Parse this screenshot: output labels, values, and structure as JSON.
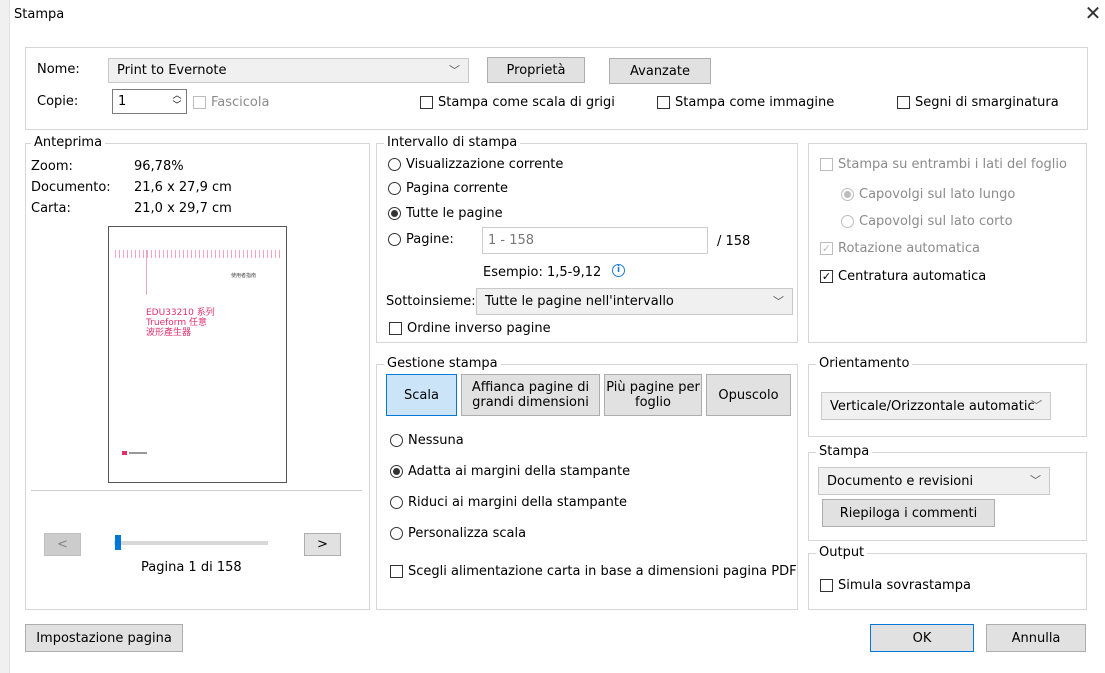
{
  "window": {
    "title": "Stampa",
    "close_icon": "close-icon"
  },
  "printer": {
    "name_label": "Nome:",
    "name_value": "Print to Evernote",
    "properties_label": "Proprietà",
    "advanced_label": "Avanzate",
    "copies_label": "Copie:",
    "copies_value": "1",
    "collate_label": "Fascicola",
    "grayscale_label": "Stampa come scala di grigi",
    "as_image_label": "Stampa come immagine",
    "crop_marks_label": "Segni di smarginatura"
  },
  "preview": {
    "legend": "Anteprima",
    "zoom_label": "Zoom:",
    "zoom_value": "96,78%",
    "document_label": "Documento:",
    "document_value": "21,6 x 27,9 cm",
    "paper_label": "Carta:",
    "paper_value": "21,0 x 29,7 cm",
    "thumb_line1": "EDU33210 系列",
    "thumb_line2": "Trueform 任意",
    "thumb_line3": "波形產生器",
    "thumb_header": "使用者指南",
    "prev_label": "<",
    "next_label": ">",
    "page_status": "Pagina 1 di 158",
    "page_slider_fraction": 0.006
  },
  "range": {
    "legend": "Intervallo di stampa",
    "current_view_label": "Visualizzazione corrente",
    "current_page_label": "Pagina corrente",
    "all_pages_label": "Tutte le pagine",
    "pages_label": "Pagine:",
    "pages_value": "1 - 158",
    "pages_total": "/ 158",
    "example_label": "Esempio: 1,5-9,12",
    "subset_label": "Sottoinsieme:",
    "subset_value": "Tutte le pagine nell'intervallo",
    "reverse_label": "Ordine inverso pagine"
  },
  "duplex": {
    "both_sides_label": "Stampa su entrambi i lati del foglio",
    "long_edge_label": "Capovolgi sul lato lungo",
    "short_edge_label": "Capovolgi sul lato corto",
    "auto_rotate_label": "Rotazione automatica",
    "auto_center_label": "Centratura automatica"
  },
  "handling": {
    "legend": "Gestione stampa",
    "tab_scale": "Scala",
    "tab_tile": "Affianca pagine di grandi dimensioni",
    "tab_multiple": "Più pagine per foglio",
    "tab_booklet": "Opuscolo",
    "none_label": "Nessuna",
    "fit_label": "Adatta ai margini della stampante",
    "shrink_label": "Riduci ai margini della stampante",
    "custom_label": "Personalizza scala",
    "paper_source_label": "Scegli alimentazione carta in base a dimensioni pagina PDF"
  },
  "orientation": {
    "legend": "Orientamento",
    "value": "Verticale/Orizzontale automatic"
  },
  "print_what": {
    "legend": "Stampa",
    "value": "Documento e revisioni",
    "summarize_label": "Riepiloga i commenti"
  },
  "output": {
    "legend": "Output",
    "simulate_label": "Simula sovrastampa"
  },
  "footer": {
    "page_setup_label": "Impostazione pagina",
    "ok_label": "OK",
    "cancel_label": "Annulla"
  },
  "colors": {
    "accent": "#0078d7",
    "button_bg": "#e1e1e1",
    "active_tab_bg": "#cce4f7",
    "info_icon": "#1e7bd2",
    "thumb_text": "#e0306a"
  }
}
